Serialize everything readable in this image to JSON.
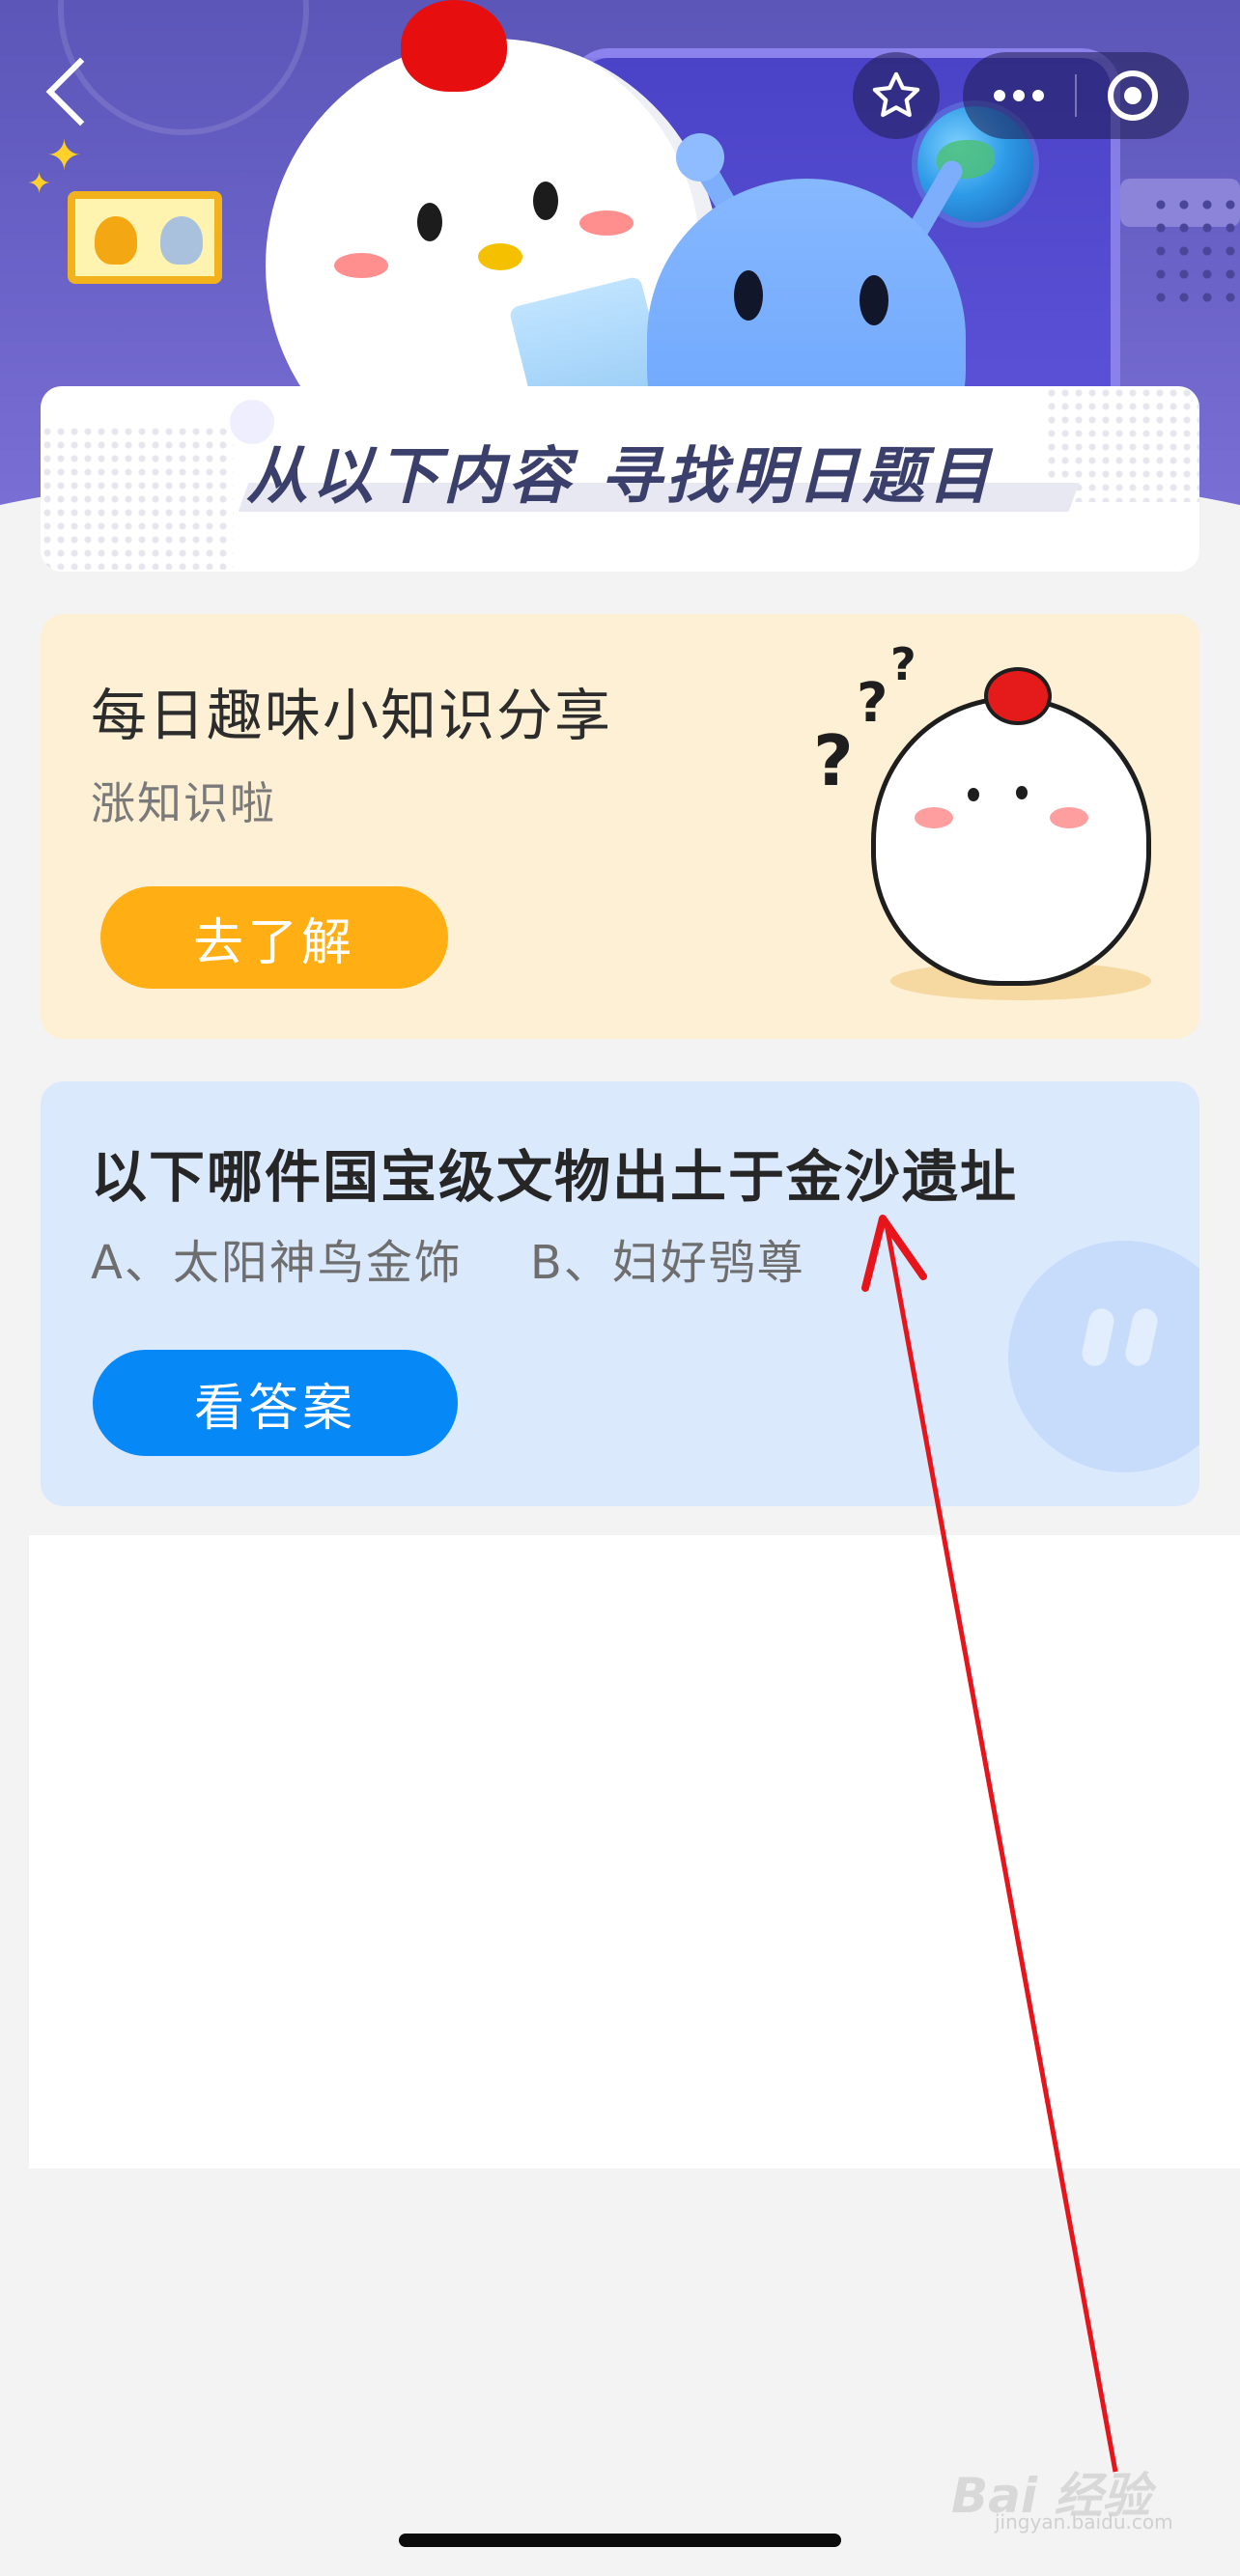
{
  "header": {
    "banner_title": "从以下内容 寻找明日题目"
  },
  "knowledge_card": {
    "title": "每日趣味小知识分享",
    "subtitle": "涨知识啦",
    "button_label": "去了解"
  },
  "question_card": {
    "question": "以下哪件国宝级文物出土于金沙遗址",
    "options": [
      "A、太阳神鸟金饰",
      "B、妇好鸮尊"
    ],
    "button_label": "看答案"
  },
  "watermark": {
    "text": "Bai 经验",
    "url_text": "jingyan.baidu.com"
  },
  "icons": [
    "back-icon",
    "favorite-star-icon",
    "more-dots-icon",
    "close-target-icon",
    "badge-frame-icon",
    "question-mark-chick-icon"
  ],
  "colors": {
    "header_bg": "#5b56b8",
    "orange_button": "#ffae13",
    "blue_button": "#0688f7",
    "knowledge_card_bg": "#fdf0d4",
    "question_card_bg": "#dbe9fd",
    "annotation_arrow": "#e8141b"
  }
}
